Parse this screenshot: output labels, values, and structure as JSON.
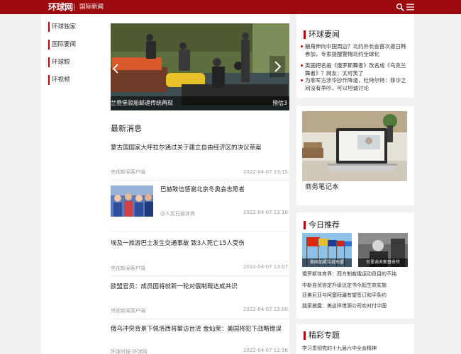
{
  "header": {
    "logo": "环球网",
    "channel": "国际新闻"
  },
  "left_nav": {
    "items": [
      {
        "label": "环球独家"
      },
      {
        "label": "国际要闻"
      },
      {
        "label": "环球眼"
      },
      {
        "label": "环视频"
      }
    ]
  },
  "slider": {
    "caption_left": "兰登堡驳船邮递传统再现",
    "caption_right": "预估3"
  },
  "latest": {
    "title": "最新消息",
    "items": [
      {
        "headline": "蒙古国国家大呼拉尔通过关于建立自由经济区的决议草案",
        "source": "央视新闻客户端",
        "time": "2022-04-07 13:15"
      },
      {
        "headline": "巴赫致信感谢北京冬奥会志愿者",
        "source": "@人民日报体育",
        "time": "2022-04-07 13:10"
      },
      {
        "headline": "埃及一旅游巴士发生交通事故 致3人死亡15人受伤",
        "source": "央视新闻客户端",
        "time": "2022-04-07 13:07"
      },
      {
        "headline": "欧盟官员：成员国将就新一轮对俄制裁达成共识",
        "source": "央视新闻客户端",
        "time": "2022-04-07 13:00"
      },
      {
        "headline": "俄乌冲突背景下佩洛西将窜访台湾 金灿荣：美国将犯下战略错误",
        "source": "环球时报-环球网",
        "time": "2022-04-07 12:56"
      }
    ]
  },
  "hot_news": {
    "title": "环球要闻",
    "items": [
      {
        "text": "触角伸向中国周边？北约外长会首次邀日韩参加，专家提醒警惕北约全球化"
      },
      {
        "text": "英国把名画《俄罗斯舞者》改名成《乌克兰舞者》？网友：太可笑了"
      },
      {
        "text": "为菲军方涉华抄作降温，杜特尔特：菲中之间没有争吵，可以坦诚讨论"
      }
    ]
  },
  "promo": {
    "caption": "商务笔记本"
  },
  "recommend": {
    "title": "今日推荐",
    "images": [
      {
        "caption": "美国加紧拉拢东盟"
      },
      {
        "caption": "日里诺夫斯基去世"
      }
    ],
    "items": [
      {
        "text": "俄罗斯体育界：西方制裁俄运动员目的不纯"
      },
      {
        "text": "中新自贸协定升级议定书今起生效实施"
      },
      {
        "text": "亚美尼亚与阿塞拜疆有望签订和平条约"
      },
      {
        "text": "独家披露：美这样借源公司欢对付中国"
      }
    ]
  },
  "special": {
    "title": "精彩专题",
    "items": [
      {
        "text": "学习贯彻党的十九届六中全会精神"
      }
    ]
  }
}
